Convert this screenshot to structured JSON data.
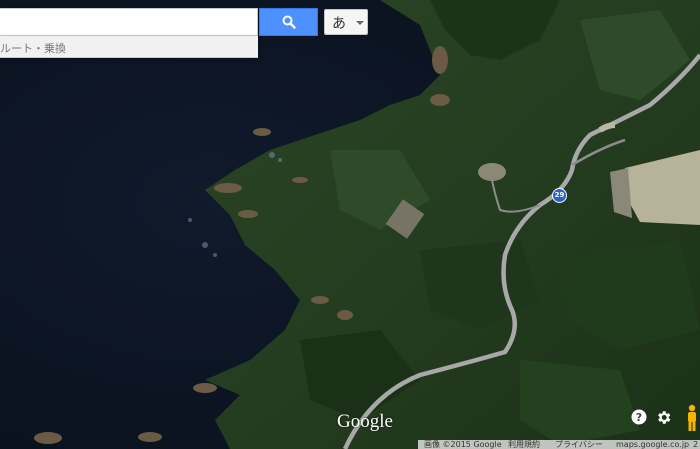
{
  "search": {
    "value": "",
    "suggestion": "ルート・乗換"
  },
  "ime": {
    "label": "あ"
  },
  "map": {
    "route_number": "29",
    "logo": "Google"
  },
  "footer": {
    "imagery": "画像 ©2015 Google",
    "terms": "利用規約",
    "privacy": "プライバシー",
    "domain": "maps.google.co.jp",
    "scale": "2"
  },
  "icons": {
    "search": "search-icon",
    "help": "help-icon",
    "settings": "gear-icon",
    "streetview": "pegman-icon"
  },
  "colors": {
    "search_button": "#4d90fe",
    "route_badge": "#2a62c9"
  }
}
